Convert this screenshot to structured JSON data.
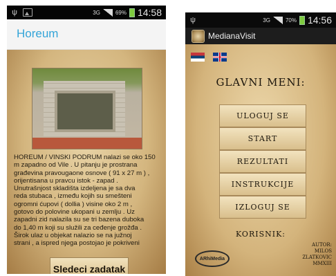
{
  "left_screen": {
    "status": {
      "network": "3G",
      "battery_pct": "69%",
      "time": "14:58"
    },
    "title": "Horeum",
    "body_lines": [
      "HOREUM / VINSKI PODRUM nalazi se oko 150",
      "m zapadno od Vile . U pitanju je prostrana",
      "građevina pravougaone osnove ( 91 x 27 m ) ,",
      "orijentisana u pravcu istok - zapad .",
      "Unutrašnjost skladišta izdeljena je sa dva",
      "reda stubaca , između kojih su smešteni",
      "ogromni ćupovi ( dollia ) visine oko 2 m ,",
      "gotovo do polovine ukopani u zemlju . Uz",
      "zapadni zid nalazila su se tri bazena duboka",
      "do 1,40 m koji su služili za ceđenje grožđa .",
      "Širok ulaz u objekat nalazio se na južnoj",
      "strani , a ispred njega postojao je pokriveni"
    ],
    "next_button": "Sledeci zadatak"
  },
  "right_screen": {
    "status": {
      "network": "3G",
      "battery_pct": "70%",
      "time": "14:56"
    },
    "app_title": "MedianaVisit",
    "flags": [
      "serbian-flag",
      "uk-flag"
    ],
    "menu_title": "GLAVNI MENI:",
    "menu_buttons": [
      "ULOGUJ SE",
      "START",
      "REZULTATI",
      "INSTRUKCIJE",
      "IZLOGUJ SE"
    ],
    "users_label": "KORISNIK:",
    "logo_text": "ARhiMedia",
    "author_lines": [
      "AUTOR:",
      "MILOS",
      "ZLATKOVIC",
      "MMXIII"
    ]
  }
}
